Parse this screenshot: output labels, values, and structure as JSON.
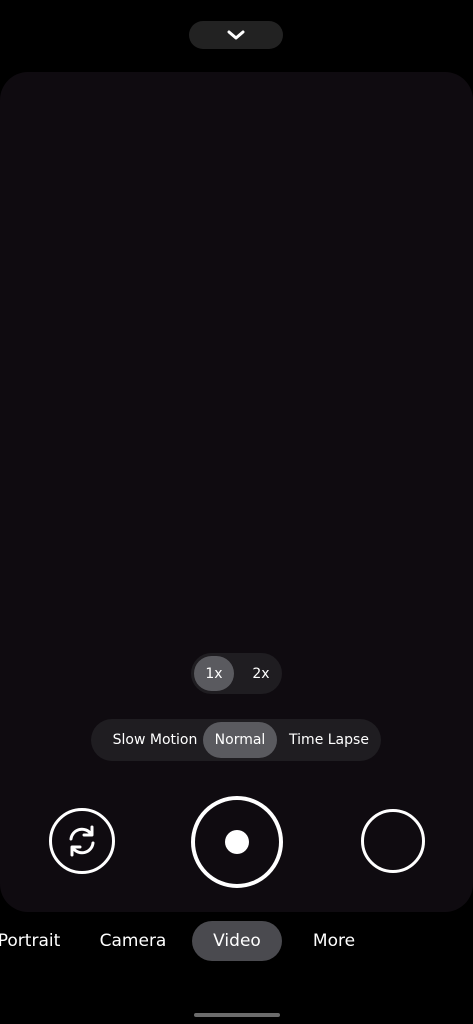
{
  "top": {
    "expand_icon": "chevron-down-icon"
  },
  "zoom": {
    "options": [
      "1x",
      "2x"
    ],
    "selected": "1x"
  },
  "video_speed": {
    "options": [
      "Slow Motion",
      "Normal",
      "Time Lapse"
    ],
    "selected": "Normal"
  },
  "controls": {
    "switch_camera_icon": "rotate-camera-icon",
    "shutter_icon": "record-dot-icon"
  },
  "modes": {
    "items": [
      "Portrait",
      "Camera",
      "Video",
      "More"
    ],
    "selected": "Video"
  },
  "colors": {
    "background": "#000000",
    "viewfinder": "#0f0b10",
    "pill": "#1f1d21",
    "selected_pill": "#5a5a5f",
    "mode_selected": "#4a4a4f",
    "foreground": "#ffffff"
  }
}
